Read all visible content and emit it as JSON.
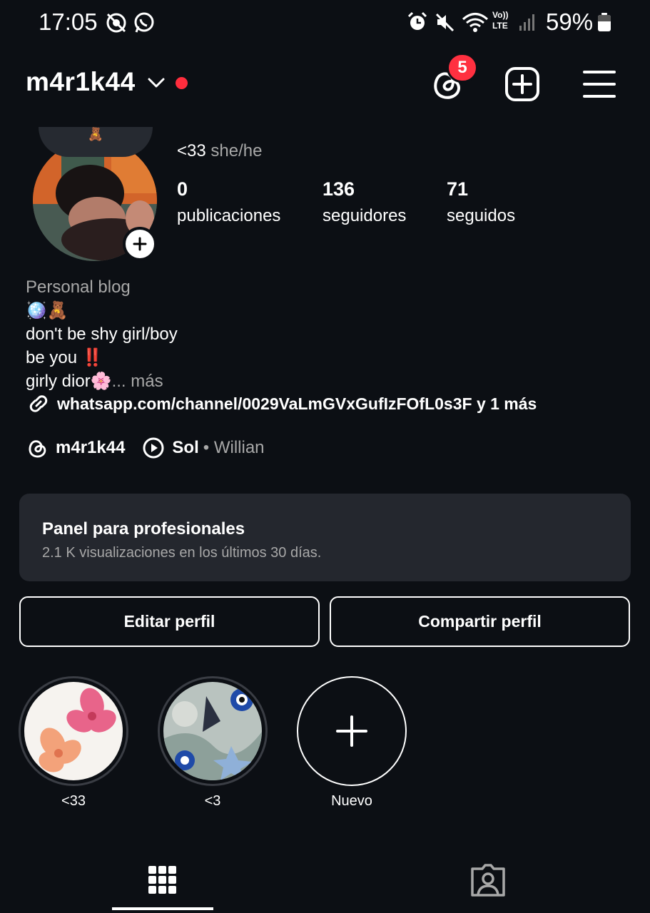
{
  "status_bar": {
    "time": "17:05",
    "battery": "59%",
    "icons": [
      "no-data-saver-icon",
      "whatsapp-icon",
      "alarm-icon",
      "mute-icon",
      "wifi-icon",
      "volte-icon",
      "signal-icon",
      "battery-icon"
    ],
    "network_label_top": "Vo))",
    "network_label_bottom": "LTE"
  },
  "header": {
    "username": "m4r1k44",
    "threads_badge": "5",
    "icons": [
      "chevron-down-icon",
      "threads-icon",
      "create-post-icon",
      "menu-icon"
    ],
    "live_dot_color": "#ff2d3d"
  },
  "profile": {
    "note_emoji": "🧸",
    "name": "<33",
    "pronouns": "she/he",
    "stats": [
      {
        "value": "0",
        "label": "publicaciones"
      },
      {
        "value": "136",
        "label": "seguidores"
      },
      {
        "value": "71",
        "label": "seguidos"
      }
    ]
  },
  "bio": {
    "category": "Personal blog",
    "line1": "🪩🧸",
    "line2": "don't be shy girl/boy",
    "line3": "be you ‼️",
    "line4": "girly dior🌸",
    "more": "... más",
    "link": "whatsapp.com/channel/0029VaLmGVxGufIzFOfL0s3F y 1 más"
  },
  "meta": {
    "threads_handle": "m4r1k44",
    "song": "Sol",
    "artist": "• Willian"
  },
  "dashboard": {
    "title": "Panel para profesionales",
    "subtitle": "2.1 K visualizaciones en los últimos 30 días."
  },
  "actions": {
    "edit": "Editar perfil",
    "share": "Compartir perfil"
  },
  "highlights": [
    {
      "label": "<33"
    },
    {
      "label": "<3"
    },
    {
      "label": "Nuevo"
    }
  ],
  "tabs": [
    "grid-icon",
    "tagged-icon"
  ],
  "colors": {
    "background": "#0c0f14",
    "badge": "#ff3040",
    "card": "#24272e"
  }
}
